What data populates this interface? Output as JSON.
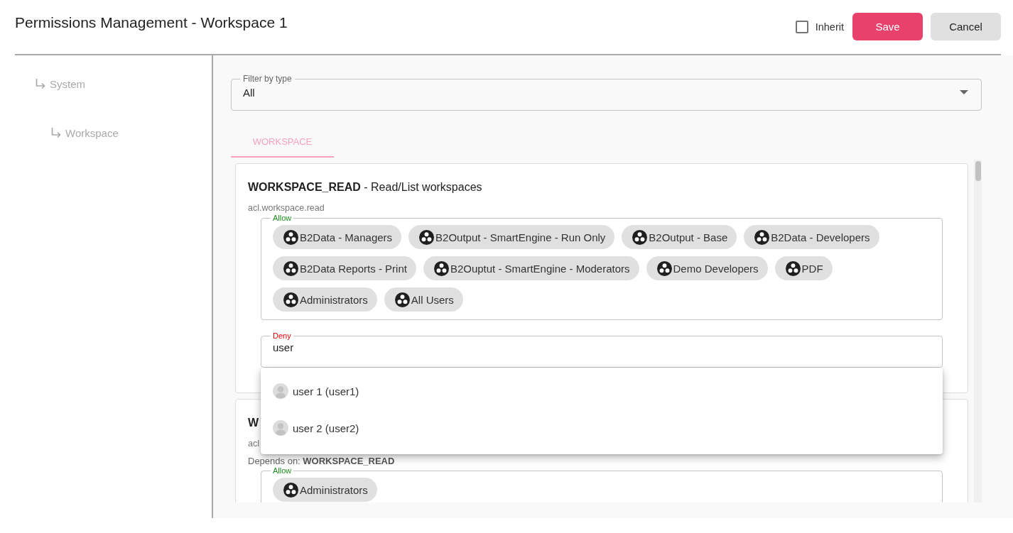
{
  "window": {
    "title": "Permissions Management - Workspace 1"
  },
  "header": {
    "inherit": {
      "label": "Inherit",
      "checked": false
    },
    "buttons": [
      {
        "label": "Save",
        "kind": "primary"
      },
      {
        "label": "Cancel",
        "kind": "secondary"
      }
    ]
  },
  "sidebar": {
    "items": [
      {
        "label": "System",
        "children": [
          {
            "label": "Workspace"
          }
        ]
      }
    ]
  },
  "filter": {
    "label": "Filter by type",
    "value": "All"
  },
  "tabs": [
    {
      "label": "WORKSPACE",
      "selected": true
    }
  ],
  "permissions": [
    {
      "name": "WORKSPACE_READ",
      "description": "- Read/List workspaces",
      "key": "acl.workspace.read",
      "allow": {
        "label": "Allow",
        "members": [
          "B2Data - Managers",
          "B2Output - SmartEngine - Run Only",
          "B2Output - Base",
          "B2Data - Developers",
          "B2Data Reports - Print",
          "B2Ouptut - SmartEngine - Moderators",
          "Demo Developers",
          "PDF",
          "Administrators",
          "All Users"
        ]
      },
      "deny": {
        "label": "Deny",
        "value": "user",
        "suggestions": [
          {
            "label": "user 1 (user1)"
          },
          {
            "label": "user 2 (user2)"
          }
        ]
      }
    },
    {
      "name": "W",
      "key": "acl",
      "depends_on": "Depends on: **WORKSPACE_READ**",
      "allow": {
        "label": "Allow",
        "members": [
          "Administrators"
        ]
      }
    }
  ]
}
